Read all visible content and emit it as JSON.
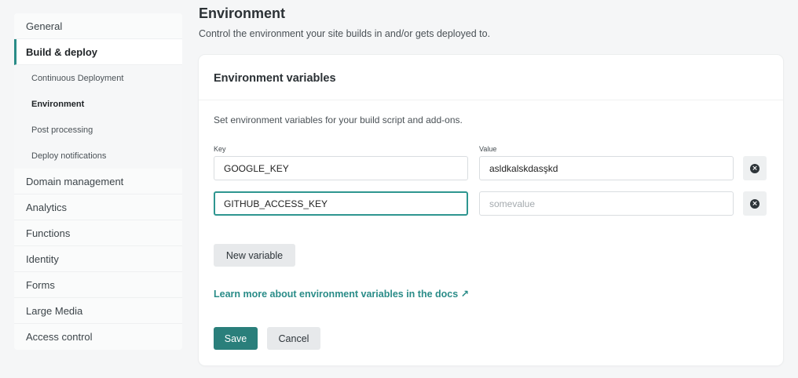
{
  "sidebar": {
    "items": [
      {
        "label": "General"
      },
      {
        "label": "Build & deploy"
      },
      {
        "label": "Continuous Deployment"
      },
      {
        "label": "Environment"
      },
      {
        "label": "Post processing"
      },
      {
        "label": "Deploy notifications"
      },
      {
        "label": "Domain management"
      },
      {
        "label": "Analytics"
      },
      {
        "label": "Functions"
      },
      {
        "label": "Identity"
      },
      {
        "label": "Forms"
      },
      {
        "label": "Large Media"
      },
      {
        "label": "Access control"
      }
    ]
  },
  "page": {
    "title": "Environment",
    "description": "Control the environment your site builds in and/or gets deployed to."
  },
  "env": {
    "title": "Environment variables",
    "description": "Set environment variables for your build script and add-ons.",
    "key_label": "Key",
    "value_label": "Value",
    "rows": [
      {
        "key": "GOOGLE_KEY",
        "value": "asldkalskdasşkd",
        "value_placeholder": ""
      },
      {
        "key": "GITHUB_ACCESS_KEY",
        "value": "",
        "value_placeholder": "somevalue"
      }
    ],
    "new_variable_label": "New variable",
    "docs_link": "Learn more about environment variables in the docs ↗",
    "save_label": "Save",
    "cancel_label": "Cancel"
  },
  "colors": {
    "accent": "#2a8c88",
    "primary_button": "#2a7f7b",
    "focus_border": "#2e9690"
  }
}
